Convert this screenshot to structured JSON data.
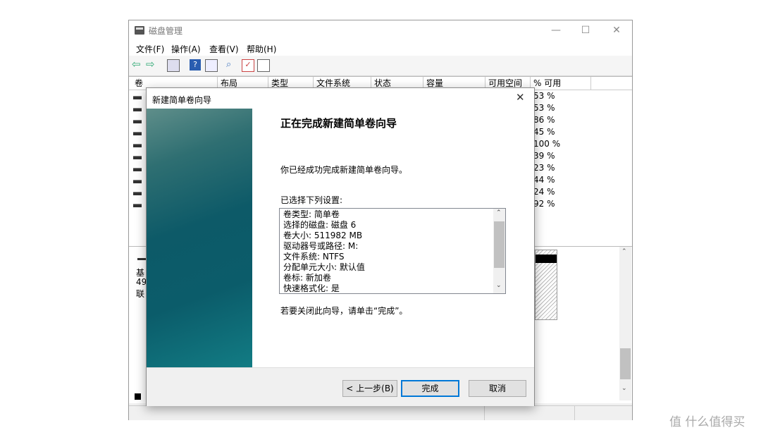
{
  "main_window": {
    "title": "磁盘管理",
    "minimize": "—",
    "maximize": "☐",
    "close": "✕",
    "menu": [
      "文件(F)",
      "操作(A)",
      "查看(V)",
      "帮助(H)"
    ],
    "columns": [
      "卷",
      "布局",
      "类型",
      "文件系统",
      "状态",
      "容量",
      "可用空间",
      "% 可用"
    ],
    "free_percent": [
      "53 %",
      "53 %",
      "86 %",
      "45 %",
      "100 %",
      "39 %",
      "23 %",
      "44 %",
      "24 %",
      "92 %"
    ],
    "disk_info": [
      "基",
      "49",
      "联"
    ]
  },
  "wizard": {
    "title": "新建简单卷向导",
    "close": "✕",
    "heading": "正在完成新建简单卷向导",
    "success_text": "你已经成功完成新建简单卷向导。",
    "settings_label": "已选择下列设置:",
    "settings": [
      "卷类型: 简单卷",
      "选择的磁盘: 磁盘 6",
      "卷大小: 511982 MB",
      "驱动器号或路径: M:",
      "文件系统: NTFS",
      "分配单元大小: 默认值",
      "卷标: 新加卷",
      "快速格式化: 是"
    ],
    "close_hint": "若要关闭此向导，请单击“完成”。",
    "buttons": {
      "back": "< 上一步(B)",
      "finish": "完成",
      "cancel": "取消"
    }
  },
  "watermark": "值 什么值得买",
  "colors": {
    "banner_dark": "#0d5a68",
    "banner_light": "#5f8e8a",
    "focus_border": "#0078d7"
  }
}
